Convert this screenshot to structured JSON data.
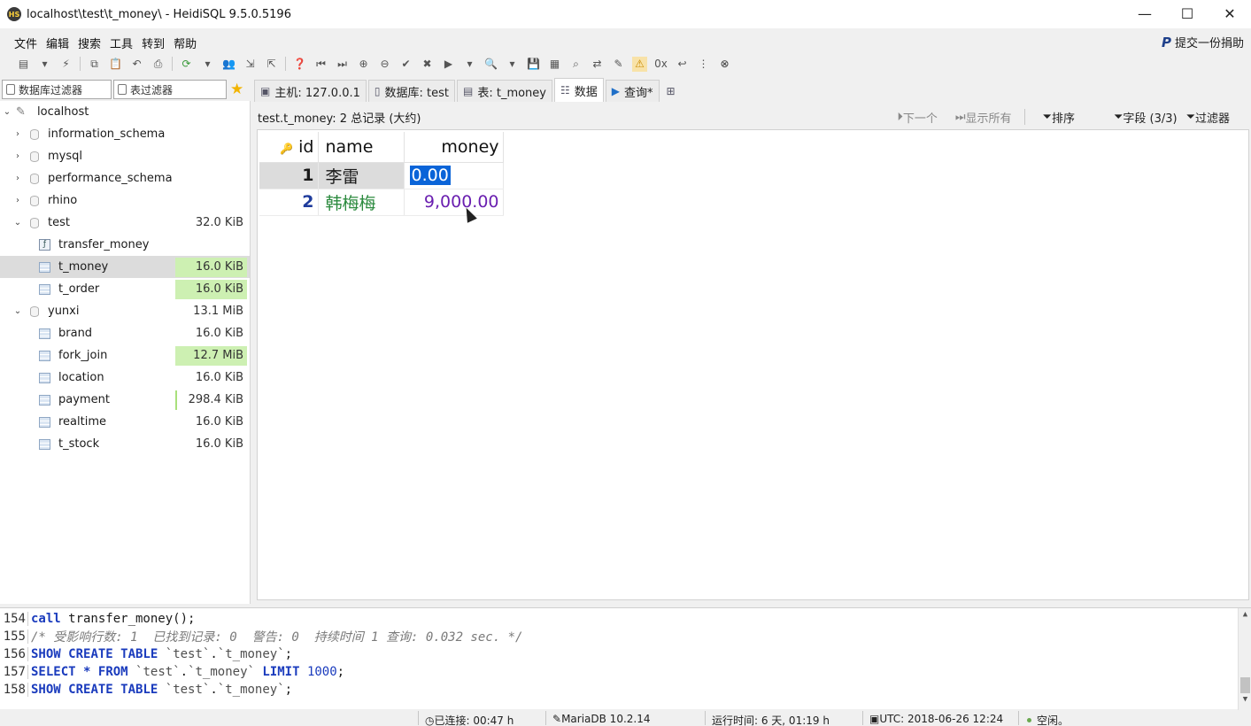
{
  "window": {
    "title": "localhost\\test\\t_money\\ - HeidiSQL 9.5.0.5196",
    "controls": [
      "—",
      "☐",
      "✕"
    ]
  },
  "menu": [
    "文件",
    "编辑",
    "搜索",
    "工具",
    "转到",
    "帮助"
  ],
  "donate": {
    "label": "提交一份捐助"
  },
  "filters": {
    "db_filter": "数据库过滤器",
    "table_filter": "表过滤器"
  },
  "tree": {
    "host": "localhost",
    "databases": [
      {
        "name": "information_schema",
        "size": ""
      },
      {
        "name": "mysql",
        "size": ""
      },
      {
        "name": "performance_schema",
        "size": ""
      },
      {
        "name": "rhino",
        "size": ""
      },
      {
        "name": "test",
        "size": "32.0 KiB"
      },
      {
        "name": "transfer_money",
        "size": ""
      },
      {
        "name": "t_money",
        "size": "16.0 KiB"
      },
      {
        "name": "t_order",
        "size": "16.0 KiB"
      },
      {
        "name": "yunxi",
        "size": "13.1 MiB"
      },
      {
        "name": "brand",
        "size": "16.0 KiB"
      },
      {
        "name": "fork_join",
        "size": "12.7 MiB"
      },
      {
        "name": "location",
        "size": "16.0 KiB"
      },
      {
        "name": "payment",
        "size": "298.4 KiB"
      },
      {
        "name": "realtime",
        "size": "16.0 KiB"
      },
      {
        "name": "t_stock",
        "size": "16.0 KiB"
      }
    ]
  },
  "tabs": [
    "主机: 127.0.0.1",
    "数据库: test",
    "表: t_money",
    "数据",
    "查询*"
  ],
  "data_header": {
    "summary": "test.t_money: 2 总记录 (大约)",
    "next": "下一个",
    "show_all": "显示所有",
    "sort": "排序",
    "fields": "字段 (3/3)",
    "filter": "过滤器"
  },
  "grid": {
    "columns": [
      "id",
      "name",
      "money"
    ],
    "rows": [
      {
        "id": "1",
        "name": "李雷",
        "money": "0.00"
      },
      {
        "id": "2",
        "name": "韩梅梅",
        "money": "9,000.00"
      }
    ]
  },
  "log": {
    "lines": [
      {
        "num": "154",
        "text": "call transfer_money();"
      },
      {
        "num": "155",
        "text": "/* 受影响行数: 1  已找到记录: 0  警告: 0  持续时间 1 查询: 0.032 sec. */"
      },
      {
        "num": "156",
        "text": "SHOW CREATE TABLE `test`.`t_money`;"
      },
      {
        "num": "157",
        "text": "SELECT * FROM `test`.`t_money` LIMIT 1000;"
      },
      {
        "num": "158",
        "text": "SHOW CREATE TABLE `test`.`t_money`;"
      }
    ]
  },
  "status": {
    "connected": "已连接: 00:47 h",
    "server": "MariaDB 10.2.14",
    "uptime": "运行时间: 6 天, 01:19 h",
    "utc": "UTC: 2018-06-26 12:24",
    "state": "空闲。"
  }
}
